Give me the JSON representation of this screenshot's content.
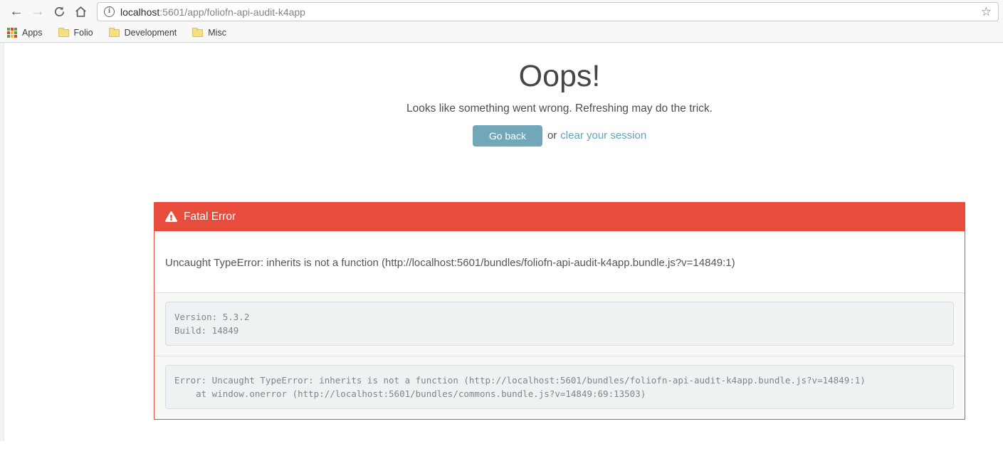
{
  "browser": {
    "url_host": "localhost",
    "url_rest": ":5601/app/foliofn-api-audit-k4app",
    "bookmarks": {
      "apps_label": "Apps",
      "folders": [
        "Folio",
        "Development",
        "Misc"
      ]
    }
  },
  "page": {
    "heading": "Oops!",
    "subtitle": "Looks like something went wrong. Refreshing may do the trick.",
    "go_back_label": "Go back",
    "or_text": "or",
    "clear_session_label": "clear your session",
    "panel": {
      "title": "Fatal Error",
      "message": "Uncaught TypeError: inherits is not a function (http://localhost:5601/bundles/foliofn-api-audit-k4app.bundle.js?v=14849:1)",
      "version_line1": "Version: 5.3.2",
      "version_line2": "Build: 14849",
      "stack_line1": "Error: Uncaught TypeError: inherits is not a function (http://localhost:5601/bundles/foliofn-api-audit-k4app.bundle.js?v=14849:1)",
      "stack_line2": "    at window.onerror (http://localhost:5601/bundles/commons.bundle.js?v=14849:69:13503)"
    }
  },
  "colors": {
    "error_red": "#e74c3c",
    "button_teal": "#72a7b9",
    "link_teal": "#64a2b3",
    "code_bg": "#eff2f2",
    "chrome_bg": "#f8f8f8"
  }
}
